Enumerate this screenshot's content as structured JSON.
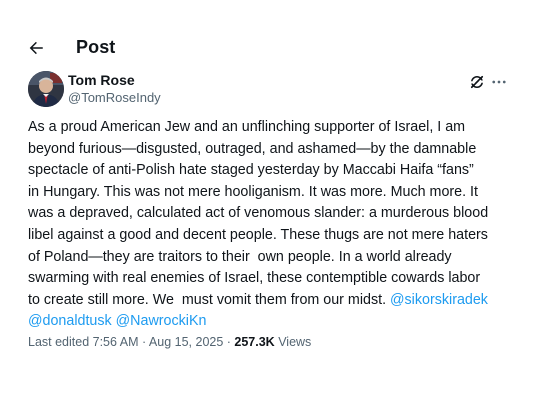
{
  "header": {
    "title": "Post",
    "back_icon": "arrow-left-icon"
  },
  "author": {
    "name": "Tom Rose",
    "handle": "@TomRoseIndy",
    "grok_icon": "grok-icon",
    "more_icon": "more-horizontal-icon"
  },
  "post": {
    "text_lines": [
      "As a proud American Jew and an unflinching supporter of Israel, I am",
      "beyond furious—disgusted, outraged, and ashamed—by the damnable",
      "spectacle of anti-Polish hate staged yesterday by Maccabi Haifa “fans”",
      "in Hungary. This was not mere hooliganism. It was more. Much more. It",
      "was a depraved, calculated act of venomous slander: a murderous blood",
      "libel against a good and decent people. These thugs are not mere haters",
      "of Poland—they are traitors to their  own people. In a world already",
      "swarming with real enemies of Israel, these contemptible cowards labor",
      "to create still more. We  must vomit them from our midst. "
    ],
    "mentions": [
      "@sikorskiradek",
      "@donaldtusk",
      "@NawrockiKn"
    ]
  },
  "meta": {
    "edited": "Last edited 7:56 AM",
    "separator": " · ",
    "date": "Aug 15, 2025",
    "views_count": "257.3K",
    "views_label": " Views"
  },
  "colors": {
    "text": "#0f1419",
    "secondary": "#536471",
    "link": "#1d9bf0"
  }
}
